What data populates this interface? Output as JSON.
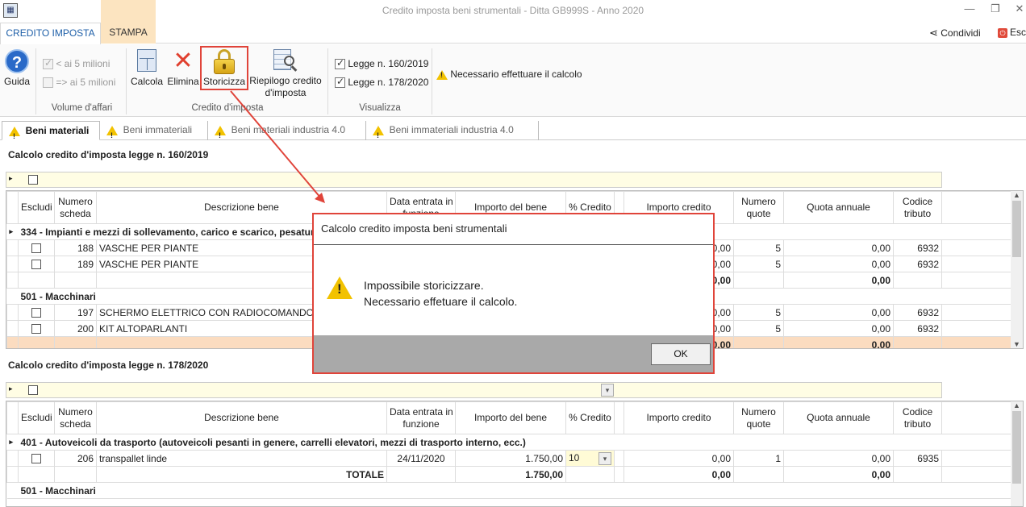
{
  "window": {
    "title": "Credito imposta beni strumentali -  Ditta GB999S - Anno 2020"
  },
  "menu_tabs": {
    "credito": "CREDITO IMPOSTA",
    "stampa": "STAMPA"
  },
  "top_right": {
    "share": "Condividi",
    "esc": "Esc"
  },
  "ribbon": {
    "guida": "Guida",
    "fatturato_lt": "< ai 5 milioni",
    "fatturato_ge": "=> ai 5 milioni",
    "volume_label": "Volume d'affari",
    "calcola": "Calcola",
    "elimina": "Elimina",
    "storicizza": "Storicizza",
    "riepilogo_l1": "Riepilogo credito",
    "riepilogo_l2": "d'imposta",
    "credito_label": "Credito d'imposta",
    "legge1": "Legge n. 160/2019",
    "legge2": "Legge n. 178/2020",
    "visualizza_label": "Visualizza",
    "warning": "Necessario effettuare il calcolo"
  },
  "subtabs": [
    "Beni materiali",
    "Beni immateriali",
    "Beni materiali industria 4.0",
    "Beni immateriali industria 4.0"
  ],
  "section1": {
    "title": "Calcolo credito d'imposta legge n. 160/2019",
    "headers": {
      "escludi": "Escludi",
      "num_l1": "Numero",
      "num_l2": "scheda",
      "desc": "Descrizione bene",
      "data_l1": "Data entrata in",
      "data_l2": "funzione",
      "importo": "Importo del bene",
      "perc": "% Credito",
      "imp_cred": "Importo credito",
      "nq_l1": "Numero",
      "nq_l2": "quote",
      "quota": "Quota annuale",
      "cod_l1": "Codice",
      "cod_l2": "tributo"
    },
    "group1": "334 - Impianti e mezzi di sollevamento, carico e scarico, pesatura, ecc.",
    "rows1": [
      {
        "num": "188",
        "desc": "VASCHE PER PIANTE",
        "imp_cred": "0,00",
        "nq": "5",
        "quota": "0,00",
        "cod": "6932"
      },
      {
        "num": "189",
        "desc": "VASCHE PER PIANTE",
        "imp_cred": "0,00",
        "nq": "5",
        "quota": "0,00",
        "cod": "6932"
      }
    ],
    "tot1": {
      "imp_cred": "0,00",
      "quota": "0,00"
    },
    "group2": "501 - Macchinari",
    "rows2": [
      {
        "num": "197",
        "desc": "SCHERMO ELETTRICO CON RADIOCOMANDO",
        "imp_cred": "0,00",
        "nq": "5",
        "quota": "0,00",
        "cod": "6932"
      },
      {
        "num": "200",
        "desc": "KIT ALTOPARLANTI",
        "imp_cred": "0,00",
        "nq": "5",
        "quota": "0,00",
        "cod": "6932"
      }
    ],
    "grand": {
      "imp_cred": "0,00",
      "quota": "0,00"
    }
  },
  "section2": {
    "title": "Calcolo credito d'imposta legge n. 178/2020",
    "group1": "401 - Autoveicoli da trasporto (autoveicoli pesanti in genere, carrelli elevatori, mezzi di trasporto interno, ecc.)",
    "row1": {
      "num": "206",
      "desc": "transpallet linde",
      "data": "24/11/2020",
      "importo": "1.750,00",
      "perc": "10",
      "imp_cred": "0,00",
      "nq": "1",
      "quota": "0,00",
      "cod": "6935"
    },
    "tot": {
      "label": "TOTALE",
      "importo": "1.750,00",
      "imp_cred": "0,00",
      "quota": "0,00"
    },
    "group2": "501 - Macchinari"
  },
  "dialog": {
    "title": "Calcolo credito imposta beni strumentali",
    "line1": "Impossibile storicizzare.",
    "line2": "Necessario effetuare il calcolo.",
    "ok": "OK"
  },
  "colors": {
    "accent": "#1e5fa8",
    "highlight": "#e0443a",
    "stampa_tab": "#fce4c0",
    "filter_row": "#fffde4",
    "total_row": "#fbdcc0"
  }
}
